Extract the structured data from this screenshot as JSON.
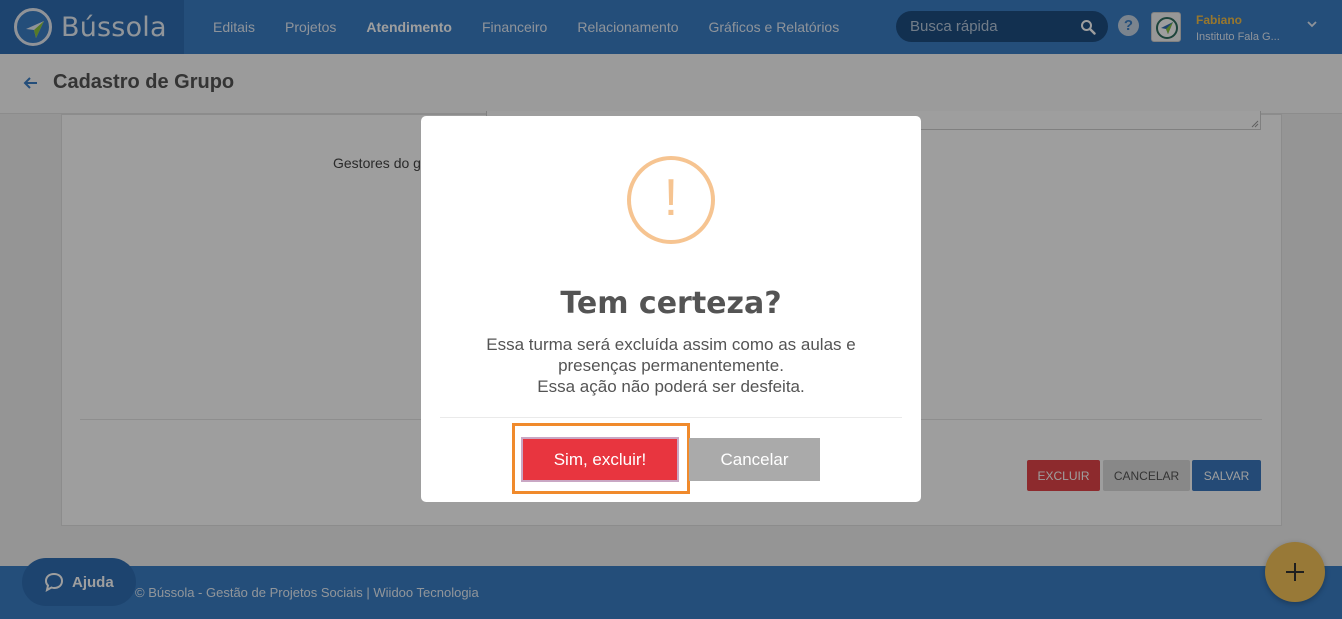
{
  "app": {
    "name": "Bússola"
  },
  "nav": {
    "items": [
      {
        "label": "Editais"
      },
      {
        "label": "Projetos"
      },
      {
        "label": "Atendimento",
        "active": true
      },
      {
        "label": "Financeiro"
      },
      {
        "label": "Relacionamento"
      },
      {
        "label": "Gráficos e Relatórios"
      }
    ]
  },
  "search": {
    "placeholder": "Busca rápida",
    "icon": "search-icon"
  },
  "user": {
    "name": "Fabiano",
    "organization": "Instituto Fala G..."
  },
  "page": {
    "title": "Cadastro de Grupo"
  },
  "form": {
    "gestores_label": "Gestores do g",
    "buttons": {
      "excluir": "EXCLUIR",
      "cancelar": "CANCELAR",
      "salvar": "SALVAR"
    }
  },
  "footer": {
    "text": "© Bússola - Gestão de Projetos Sociais  |  Wiidoo Tecnologia",
    "help_label": "Ajuda"
  },
  "modal": {
    "icon_mark": "!",
    "title": "Tem certeza?",
    "message_lines": [
      "Essa turma será excluída assim como as aulas e",
      "presenças permanentemente.",
      "Essa ação não poderá ser desfeita."
    ],
    "confirm_label": "Sim, excluir!",
    "cancel_label": "Cancelar"
  },
  "colors": {
    "nav_blue": "#3a7ec6",
    "brand_blue": "#2f6fb3",
    "danger": "#e8353f",
    "warning": "#f6c491",
    "highlight": "#f08a2c",
    "fab": "#f5c45a"
  }
}
